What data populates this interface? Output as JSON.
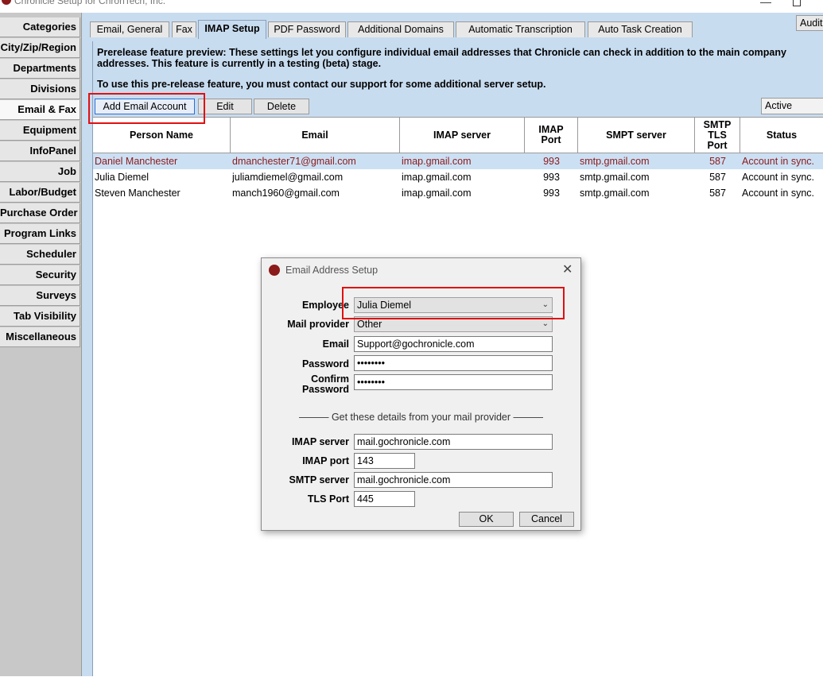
{
  "window": {
    "title": "Chronicle Setup for ChronTech, Inc.",
    "minimize": "—"
  },
  "sidebar": {
    "items": [
      {
        "label": "Categories"
      },
      {
        "label": "City/Zip/Region"
      },
      {
        "label": "Departments"
      },
      {
        "label": "Divisions"
      },
      {
        "label": "Email & Fax"
      },
      {
        "label": "Equipment"
      },
      {
        "label": "InfoPanel"
      },
      {
        "label": "Job"
      },
      {
        "label": "Labor/Budget"
      },
      {
        "label": "Purchase Order"
      },
      {
        "label": "Program Links"
      },
      {
        "label": "Scheduler"
      },
      {
        "label": "Security"
      },
      {
        "label": "Surveys"
      },
      {
        "label": "Tab Visibility"
      },
      {
        "label": "Miscellaneous"
      }
    ],
    "active": "Email & Fax"
  },
  "tabs": [
    {
      "label": "Email, General"
    },
    {
      "label": "Fax"
    },
    {
      "label": "IMAP Setup"
    },
    {
      "label": "PDF Password"
    },
    {
      "label": "Additional Domains"
    },
    {
      "label": "Automatic Transcription"
    },
    {
      "label": "Auto Task Creation"
    }
  ],
  "active_tab": "IMAP Setup",
  "audit_button": "Audit",
  "info": {
    "p1": "Prerelease feature preview: These settings let you configure individual email addresses that Chronicle can check in addition to the main company addresses. This feature is currently in a testing (beta) stage.",
    "p2": "To use this pre-release feature, you must contact our support for some additional server setup."
  },
  "toolbar": {
    "add_label": "Add Email Account",
    "edit_label": "Edit",
    "delete_label": "Delete",
    "status_filter": "Active"
  },
  "grid": {
    "columns": [
      "Person Name",
      "Email",
      "IMAP server",
      "IMAP Port",
      "SMPT server",
      "SMTP TLS Port",
      "Status"
    ],
    "rows": [
      {
        "name": "Daniel Manchester",
        "email": "dmanchester71@gmail.com",
        "imap": "imap.gmail.com",
        "imap_port": "993",
        "smtp": "smtp.gmail.com",
        "tls": "587",
        "status": "Account in sync."
      },
      {
        "name": "Julia Diemel",
        "email": "juliamdiemel@gmail.com",
        "imap": "imap.gmail.com",
        "imap_port": "993",
        "smtp": "smtp.gmail.com",
        "tls": "587",
        "status": "Account in sync."
      },
      {
        "name": "Steven Manchester",
        "email": "manch1960@gmail.com",
        "imap": "imap.gmail.com",
        "imap_port": "993",
        "smtp": "smtp.gmail.com",
        "tls": "587",
        "status": "Account in sync."
      }
    ],
    "selected_row": 0
  },
  "dialog": {
    "title": "Email Address Setup",
    "close": "✕",
    "employee_label": "Employee",
    "employee_value": "Julia Diemel",
    "provider_label": "Mail provider",
    "provider_value": "Other",
    "email_label": "Email",
    "email_value": "Support@gochronicle.com",
    "password_label": "Password",
    "password_value": "••••••••",
    "confirm_label_1": "Confirm",
    "confirm_label_2": "Password",
    "confirm_value": "••••••••",
    "separator": "——— Get these details from your mail provider ———",
    "imap_server_label": "IMAP server",
    "imap_server_value": "mail.gochronicle.com",
    "imap_port_label": "IMAP port",
    "imap_port_value": "143",
    "smtp_server_label": "SMTP server",
    "smtp_server_value": "mail.gochronicle.com",
    "tls_port_label": "TLS Port",
    "tls_port_value": "445",
    "ok_label": "OK",
    "cancel_label": "Cancel"
  },
  "colors": {
    "highlight": "#e01010",
    "selected_row_text": "#8b1a1a",
    "panel": "#c8dcf0"
  }
}
